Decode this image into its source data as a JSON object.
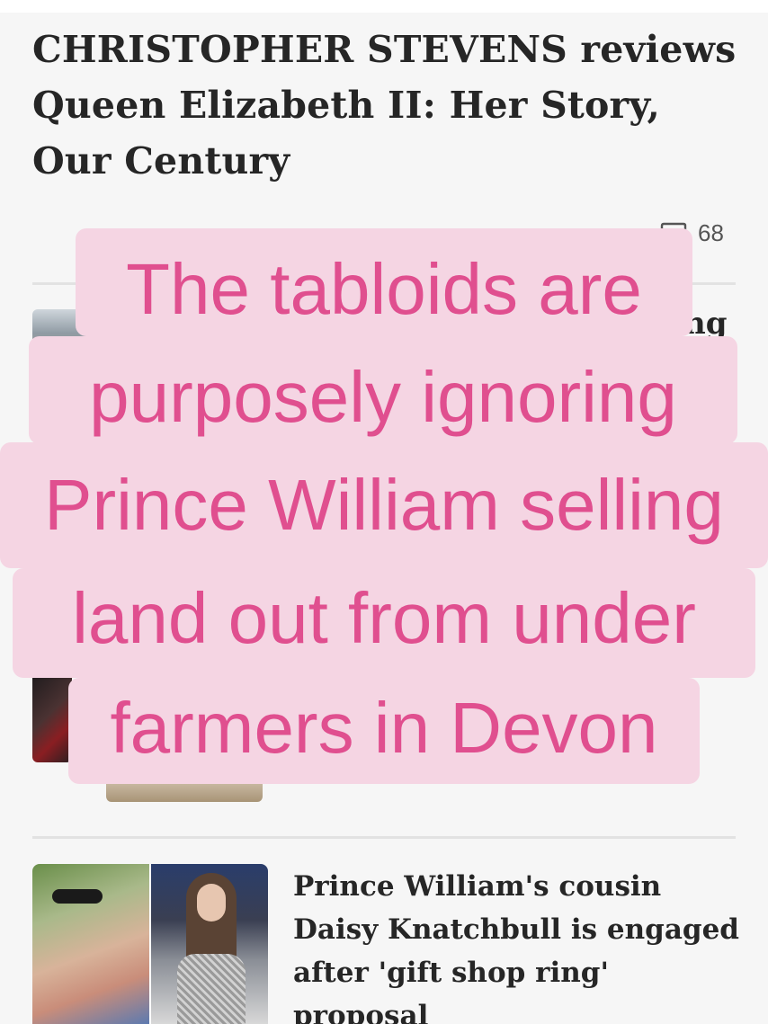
{
  "article": {
    "title": "CHRISTOPHER STEVENS reviews Queen Elizabeth II: Her Story, Our Century",
    "comment_count": "68"
  },
  "overlay": {
    "lines": [
      "The tabloids are",
      "purposely ignoring",
      "Prince William selling",
      "land out from under",
      "farmers in Devon"
    ],
    "colors": {
      "background": "#f5d5e3",
      "text": "#e04f8f"
    }
  },
  "partial_headline_fragment": "ng",
  "story": {
    "headline": "Prince William's cousin Daisy Knatchbull is engaged after 'gift shop ring' proposal"
  }
}
